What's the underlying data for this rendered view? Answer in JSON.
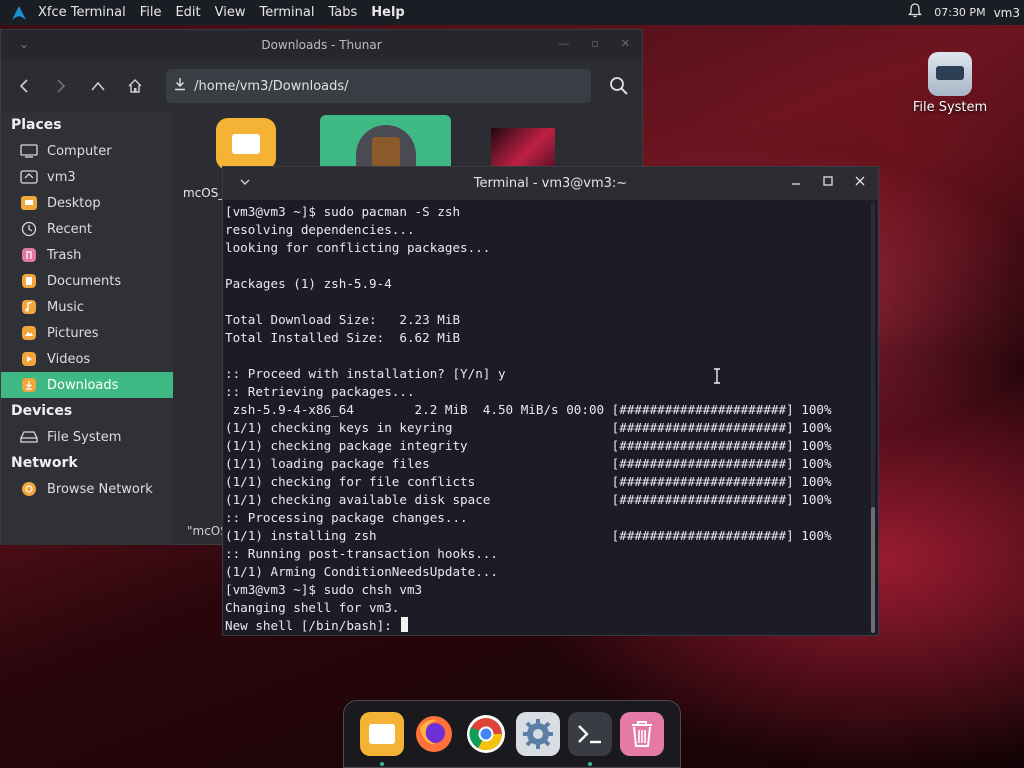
{
  "top_panel": {
    "app_name": "Xfce Terminal",
    "menu": [
      "File",
      "Edit",
      "View",
      "Terminal",
      "Tabs",
      "Help"
    ],
    "clock": "07:30 PM",
    "user": "vm3"
  },
  "desktop": {
    "icons": [
      {
        "label": "File System",
        "icon": "drive-icon"
      }
    ]
  },
  "thunar": {
    "title": "Downloads - Thunar",
    "path": "/home/vm3/Downloads/",
    "sidebar": {
      "places_header": "Places",
      "places": [
        {
          "label": "Computer",
          "icon": "computer-icon"
        },
        {
          "label": "vm3",
          "icon": "home-icon"
        },
        {
          "label": "Desktop",
          "icon": "desktop-folder-icon"
        },
        {
          "label": "Recent",
          "icon": "recent-icon"
        },
        {
          "label": "Trash",
          "icon": "trash-icon"
        },
        {
          "label": "Documents",
          "icon": "documents-icon"
        },
        {
          "label": "Music",
          "icon": "music-icon"
        },
        {
          "label": "Pictures",
          "icon": "pictures-icon"
        },
        {
          "label": "Videos",
          "icon": "videos-icon"
        },
        {
          "label": "Downloads",
          "icon": "downloads-icon",
          "active": true
        }
      ],
      "devices_header": "Devices",
      "devices": [
        {
          "label": "File System",
          "icon": "drive-icon"
        }
      ],
      "network_header": "Network",
      "network": [
        {
          "label": "Browse Network",
          "icon": "network-icon"
        }
      ]
    },
    "files": [
      {
        "label": "mcOS_",
        "icon": "folder-icon"
      },
      {
        "label": "",
        "icon": "archive-icon"
      },
      {
        "label": "",
        "icon": "image-thumbnail-icon"
      }
    ],
    "status": "\"mcOS"
  },
  "terminal": {
    "title": "Terminal - vm3@vm3:~",
    "lines": [
      "[vm3@vm3 ~]$ sudo pacman -S zsh",
      "resolving dependencies...",
      "looking for conflicting packages...",
      "",
      "Packages (1) zsh-5.9-4",
      "",
      "Total Download Size:   2.23 MiB",
      "Total Installed Size:  6.62 MiB",
      "",
      ":: Proceed with installation? [Y/n] y",
      ":: Retrieving packages...",
      " zsh-5.9-4-x86_64        2.2 MiB  4.50 MiB/s 00:00 [######################] 100%",
      "(1/1) checking keys in keyring                     [######################] 100%",
      "(1/1) checking package integrity                   [######################] 100%",
      "(1/1) loading package files                        [######################] 100%",
      "(1/1) checking for file conflicts                  [######################] 100%",
      "(1/1) checking available disk space                [######################] 100%",
      ":: Processing package changes...",
      "(1/1) installing zsh                               [######################] 100%",
      ":: Running post-transaction hooks...",
      "(1/1) Arming ConditionNeedsUpdate...",
      "[vm3@vm3 ~]$ sudo chsh vm3",
      "Changing shell for vm3.",
      "New shell [/bin/bash]: "
    ]
  },
  "dock": {
    "items": [
      {
        "name": "files",
        "icon": "folder-icon",
        "color": "#f4b334",
        "running": true
      },
      {
        "name": "firefox",
        "icon": "firefox-icon",
        "color": "#ff7139",
        "running": false
      },
      {
        "name": "chrome",
        "icon": "chrome-icon",
        "color": "#ffffff",
        "running": false
      },
      {
        "name": "settings",
        "icon": "gear-icon",
        "color": "#5a7ea6",
        "running": false
      },
      {
        "name": "terminal",
        "icon": "terminal-icon",
        "color": "#2b2d33",
        "running": true
      },
      {
        "name": "trash",
        "icon": "trash-icon",
        "color": "#e57aa6",
        "running": false
      }
    ]
  },
  "colors": {
    "accent": "#3fb984",
    "panel": "#1b1d24",
    "terminal_bg": "#1c1c27"
  }
}
